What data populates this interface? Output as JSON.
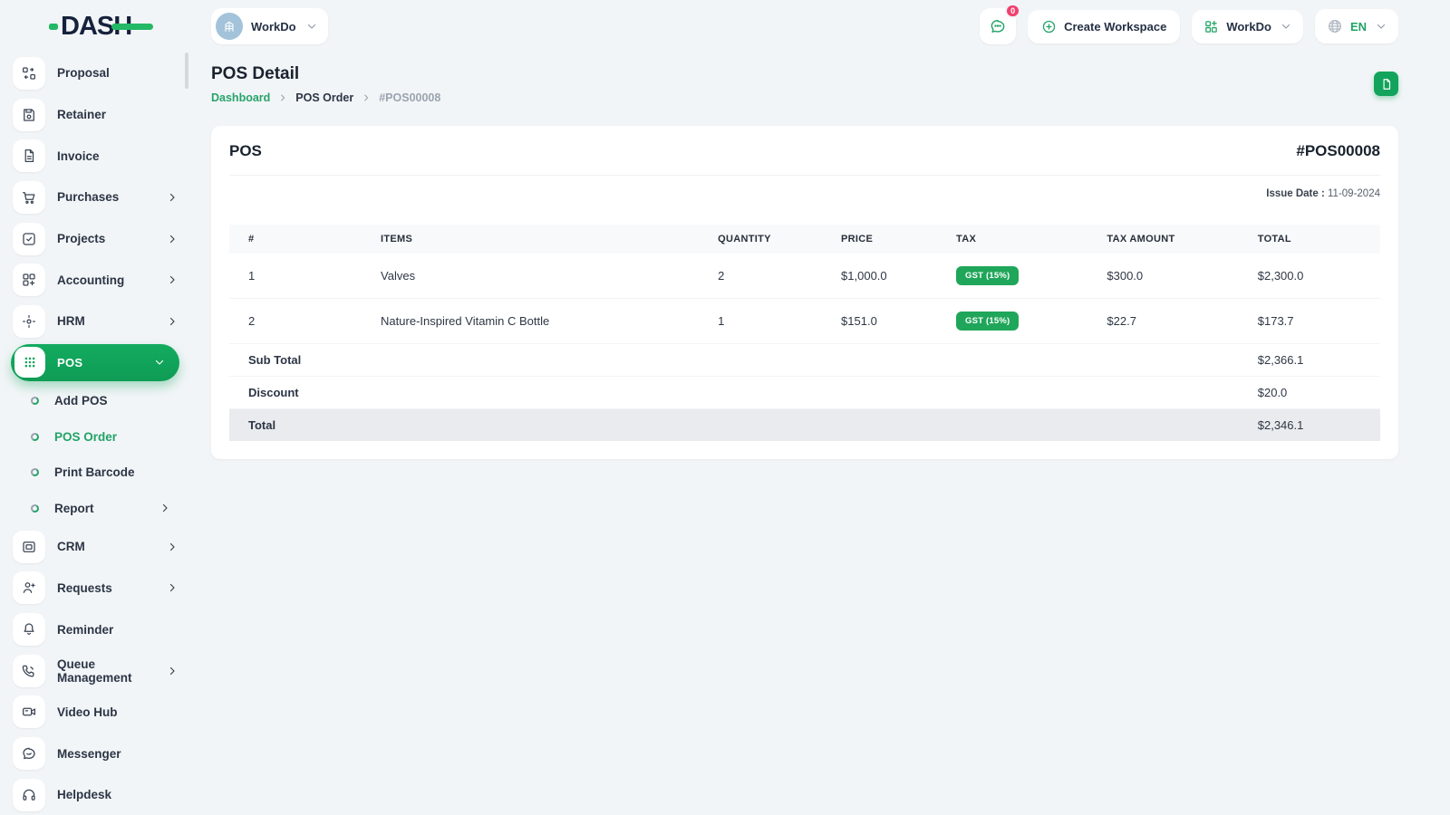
{
  "brand": {
    "name": "DASH"
  },
  "colors": {
    "primary_green": "#12a45c",
    "logo_green": "#22b866",
    "logo_navy": "#16223c",
    "link_green": "#21a366",
    "badge_pink": "#f2416e",
    "badge_tax_green": "#1fa65a"
  },
  "topbar": {
    "workspace": {
      "label": "WorkDo",
      "icon": "building-icon"
    },
    "chat": {
      "icon": "chat-bubble-icon",
      "badge": "0"
    },
    "create_workspace_label": "Create Workspace",
    "workdo_menu_label": "WorkDo",
    "language": "EN"
  },
  "sidebar": {
    "items": [
      {
        "label": "Proposal",
        "icon": "proposal-icon"
      },
      {
        "label": "Retainer",
        "icon": "retainer-icon"
      },
      {
        "label": "Invoice",
        "icon": "invoice-icon"
      },
      {
        "label": "Purchases",
        "icon": "cart-icon"
      },
      {
        "label": "Projects",
        "icon": "check-square-icon"
      },
      {
        "label": "Accounting",
        "icon": "accounting-grid-icon"
      },
      {
        "label": "HRM",
        "icon": "hrm-icon"
      },
      {
        "label": "POS",
        "icon": "pos-grid-icon"
      },
      {
        "label": "CRM",
        "icon": "crm-icon"
      },
      {
        "label": "Requests",
        "icon": "user-plus-icon"
      },
      {
        "label": "Reminder",
        "icon": "bell-icon"
      },
      {
        "label": "Queue Management",
        "icon": "phone-icon"
      },
      {
        "label": "Video Hub",
        "icon": "video-icon"
      },
      {
        "label": "Messenger",
        "icon": "message-icon"
      },
      {
        "label": "Helpdesk",
        "icon": "headset-icon"
      }
    ],
    "pos_submenu": [
      {
        "label": "Add POS"
      },
      {
        "label": "POS Order",
        "active": true
      },
      {
        "label": "Print Barcode"
      },
      {
        "label": "Report"
      }
    ]
  },
  "page": {
    "title": "POS Detail",
    "breadcrumb": {
      "home": "Dashboard",
      "section": "POS Order",
      "current": "#POS00008"
    }
  },
  "pos_card": {
    "title": "POS",
    "number": "#POS00008",
    "issue_date_label": "Issue Date :",
    "issue_date": "11-09-2024",
    "table": {
      "headers": [
        "#",
        "ITEMS",
        "QUANTITY",
        "PRICE",
        "TAX",
        "TAX AMOUNT",
        "TOTAL"
      ],
      "rows": [
        {
          "index": "1",
          "item": "Valves",
          "quantity": "2",
          "price": "$1,000.0",
          "tax": "GST (15%)",
          "tax_amount": "$300.0",
          "total": "$2,300.0"
        },
        {
          "index": "2",
          "item": "Nature-Inspired Vitamin C Bottle",
          "quantity": "1",
          "price": "$151.0",
          "tax": "GST (15%)",
          "tax_amount": "$22.7",
          "total": "$173.7"
        }
      ],
      "summary": [
        {
          "label": "Sub Total",
          "value": "$2,366.1"
        },
        {
          "label": "Discount",
          "value": "$20.0"
        },
        {
          "label": "Total",
          "value": "$2,346.1"
        }
      ]
    }
  }
}
